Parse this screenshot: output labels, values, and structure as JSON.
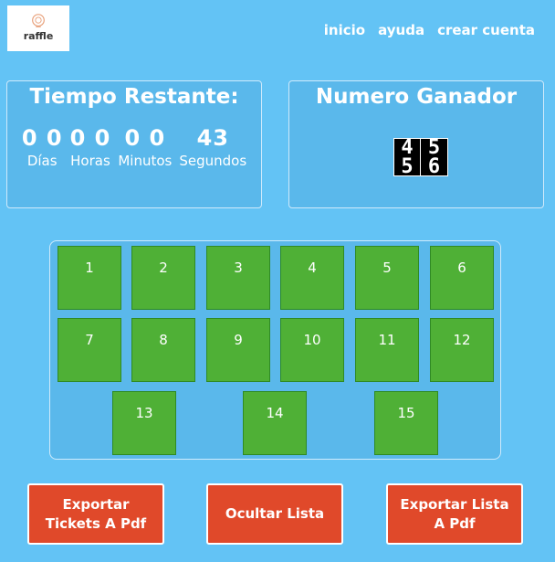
{
  "header": {
    "logo_text": "raffle",
    "nav": [
      "inicio",
      "ayuda",
      "crear cuenta"
    ]
  },
  "timer": {
    "title": "Tiempo Restante:",
    "units": [
      {
        "value": "0 0",
        "label": "Días"
      },
      {
        "value": "0 0",
        "label": "Horas"
      },
      {
        "value": "0 0",
        "label": "Minutos"
      },
      {
        "value": "43",
        "label": "Segundos"
      }
    ]
  },
  "winner": {
    "title": "Numero Ganador",
    "digits": [
      {
        "top": "4",
        "bottom": "5"
      },
      {
        "top": "5",
        "bottom": "6"
      }
    ]
  },
  "tickets": [
    "1",
    "2",
    "3",
    "4",
    "5",
    "6",
    "7",
    "8",
    "9",
    "10",
    "11",
    "12",
    "13",
    "14",
    "15"
  ],
  "actions": {
    "export_tickets": "Exportar Tickets A Pdf",
    "hide_list": "Ocultar Lista",
    "export_list": "Exportar Lista A Pdf"
  },
  "colors": {
    "background": "#63c3f5",
    "ticket": "#4fb036",
    "button": "#e0492a"
  }
}
